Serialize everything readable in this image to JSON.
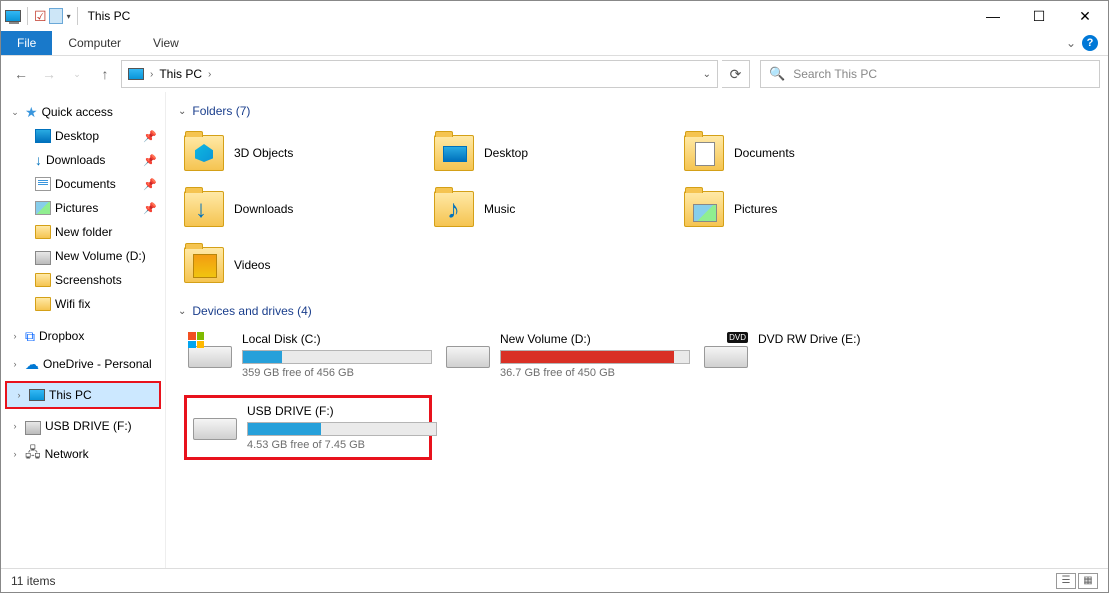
{
  "title": "This PC",
  "ribbon": {
    "file": "File",
    "computer": "Computer",
    "view": "View"
  },
  "breadcrumb": {
    "location": "This PC"
  },
  "search": {
    "placeholder": "Search This PC"
  },
  "sidebar": {
    "quickaccess": "Quick access",
    "items": [
      {
        "label": "Desktop",
        "pinned": true
      },
      {
        "label": "Downloads",
        "pinned": true
      },
      {
        "label": "Documents",
        "pinned": true
      },
      {
        "label": "Pictures",
        "pinned": true
      },
      {
        "label": "New folder",
        "pinned": false
      },
      {
        "label": "New Volume (D:)",
        "pinned": false
      },
      {
        "label": "Screenshots",
        "pinned": false
      },
      {
        "label": "Wifi fix",
        "pinned": false
      }
    ],
    "dropbox": "Dropbox",
    "onedrive": "OneDrive - Personal",
    "thispc": "This PC",
    "usbdrive": "USB DRIVE (F:)",
    "network": "Network"
  },
  "groups": {
    "folders_header": "Folders (7)",
    "drives_header": "Devices and drives (4)"
  },
  "folders": [
    {
      "label": "3D Objects",
      "cls": "f-3d"
    },
    {
      "label": "Desktop",
      "cls": "f-desktop"
    },
    {
      "label": "Documents",
      "cls": "f-documents"
    },
    {
      "label": "Downloads",
      "cls": "f-downloads"
    },
    {
      "label": "Music",
      "cls": "f-music"
    },
    {
      "label": "Pictures",
      "cls": "f-pictures"
    },
    {
      "label": "Videos",
      "cls": "f-videos"
    }
  ],
  "drives": [
    {
      "name": "Local Disk (C:)",
      "free": "359 GB free of 456 GB",
      "fill": 21,
      "color": "blue",
      "badge": "win"
    },
    {
      "name": "New Volume (D:)",
      "free": "36.7 GB free of 450 GB",
      "fill": 92,
      "color": "red",
      "badge": ""
    },
    {
      "name": "DVD RW Drive (E:)",
      "free": "",
      "fill": -1,
      "color": "",
      "badge": "dvd"
    },
    {
      "name": "USB DRIVE (F:)",
      "free": "4.53 GB free of 7.45 GB",
      "fill": 39,
      "color": "blue",
      "badge": "",
      "highlight": true
    }
  ],
  "statusbar": {
    "count": "11 items"
  }
}
